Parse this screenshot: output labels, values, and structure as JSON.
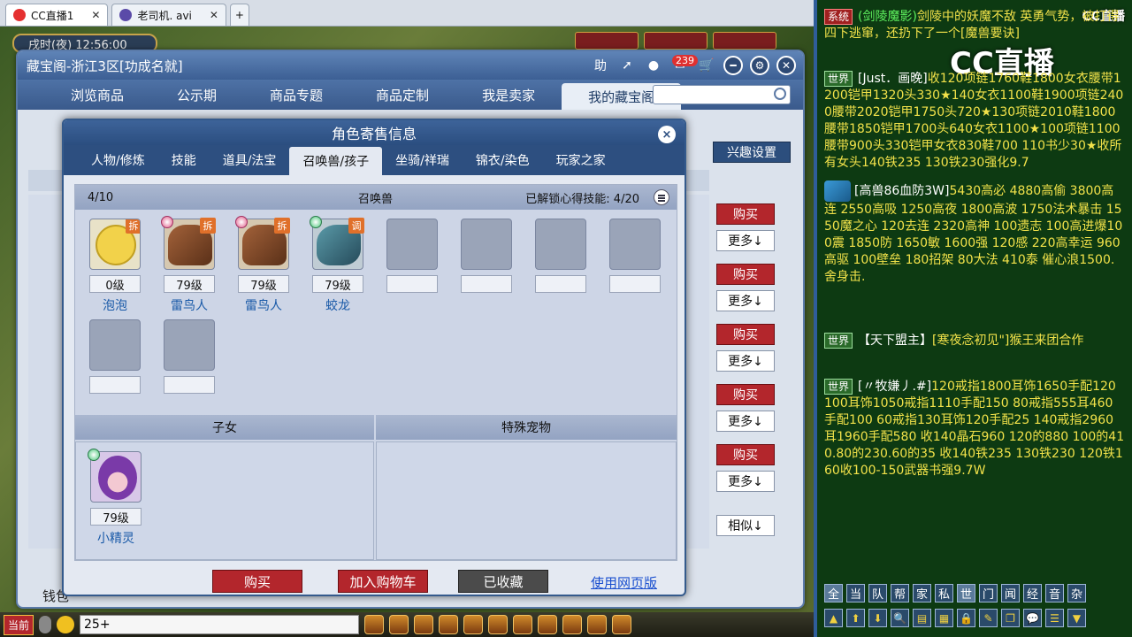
{
  "browser_tabs": [
    {
      "label": "CC直播1",
      "active": true
    },
    {
      "label": "老司机. avi",
      "active": false
    }
  ],
  "game": {
    "time_text": "戌时(夜) 12:56:00",
    "panel_title": "藏宝阁-浙江3区[功成名就]",
    "help_label": "助",
    "cart_badge": "239",
    "nav": [
      "浏览商品",
      "公示期",
      "商品专题",
      "商品定制",
      "我是卖家",
      "我的藏宝阁"
    ],
    "interest_button": "兴趣设置",
    "side_buttons": [
      {
        "buy": "购买",
        "more": "更多↓"
      },
      {
        "buy": "购买",
        "more": "更多↓"
      },
      {
        "buy": "购买",
        "more": "更多↓"
      },
      {
        "buy": "购买",
        "more": "更多↓"
      },
      {
        "buy": "购买",
        "more": "更多↓"
      }
    ],
    "similar_button": "相似↓",
    "money_label": "钱包"
  },
  "popup": {
    "title": "角色寄售信息",
    "close": "×",
    "tabs": [
      "人物/修炼",
      "技能",
      "道具/法宝",
      "召唤兽/孩子",
      "坐骑/祥瑞",
      "锦衣/染色",
      "玩家之家"
    ],
    "summon": {
      "count": "4/10",
      "label": "召唤兽",
      "skills": "已解锁心得技能:  4/20",
      "pets": [
        {
          "level": "0级",
          "name": "泡泡",
          "tag": "拆"
        },
        {
          "level": "79级",
          "name": "雷鸟人",
          "tag": "拆"
        },
        {
          "level": "79级",
          "name": "雷鸟人",
          "tag": "拆"
        },
        {
          "level": "79级",
          "name": "蛟龙",
          "tag": "调"
        }
      ]
    },
    "children_header": "子女",
    "special_header": "特殊宠物",
    "child": {
      "level": "79级",
      "name": "小精灵"
    },
    "buttons": {
      "buy": "购买",
      "add_cart": "加入购物车",
      "collected": "已收藏",
      "web": "使用网页版"
    }
  },
  "bottom_bar": {
    "current_channel": "当前",
    "chat_input": "25+"
  },
  "chat": {
    "logo": "CC直播",
    "logo_small": "CC直播",
    "messages": [
      {
        "channel": "系统",
        "sender": "(剑陵魔影)",
        "text": "剑陵中的妖魔不敌 英勇气势，被打得四下逃窜，还扔下了一个[魔兽要诀]"
      },
      {
        "channel": "世界",
        "sender": "[Just．画晚]",
        "text": "收120项链1760鞋1800女衣腰带1200铠甲1320头330★140女衣1100鞋1900项链2400腰带2020铠甲1750头720★130项链2010鞋1800腰带1850铠甲1700头640女衣1100★100项链1100腰带900头330铠甲女衣830鞋700 110书少30★收所有女头140铁235 130铁230强化9.7"
      },
      {
        "channel": "",
        "sender": "[高兽86血防3W]",
        "text": "5430高必 4880高偷 3800高连 2550高吸 1250高夜 1800高波 1750法术暴击 1550魔之心 120去连 2320高神 100遗志 100高进爆100震 1850防 1650敏 1600强 120感 220高幸运 960高驱 100壁垒 180招架 80大法 410泰 催心浪1500.舍身击."
      },
      {
        "channel": "世界",
        "sender": "【天下盟主】",
        "text": "[寒夜念初见\"]猴王来团合作"
      },
      {
        "channel": "世界",
        "sender": "[〃牧嫌丿.#]",
        "text": "120戒指1800耳饰1650手配120 100耳饰1050戒指1110手配150 80戒指555耳460手配100 60戒指130耳饰120手配25 140戒指2960耳1960手配580 收140晶石960 120的880 100的410.80的230.60的35 收140铁235 130铁230 120铁160收100-150武器书强9.7W"
      }
    ],
    "tabs": [
      "全",
      "当",
      "队",
      "帮",
      "家",
      "私",
      "世",
      "门",
      "闻",
      "经",
      "音",
      "杂"
    ]
  }
}
